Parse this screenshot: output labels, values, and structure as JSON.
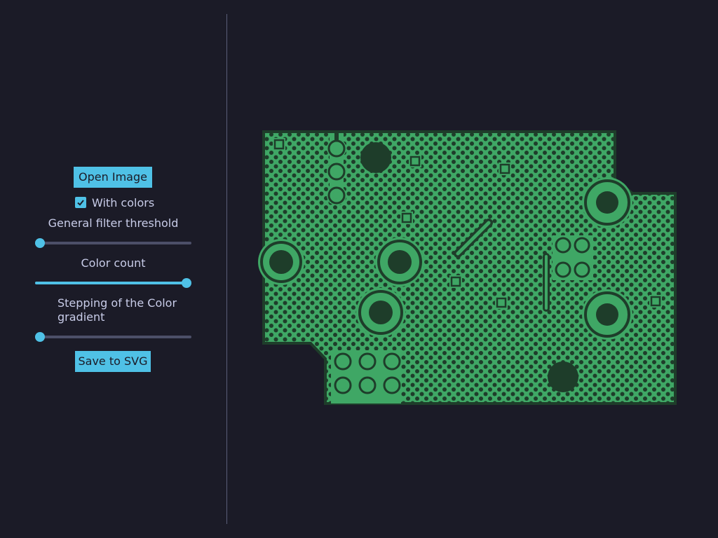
{
  "controls": {
    "open_button": "Open Image",
    "with_colors_label": "With colors",
    "with_colors_checked": true,
    "filter_threshold_label": "General filter threshold",
    "filter_threshold_value": 0.0,
    "color_count_label": "Color count",
    "color_count_value": 1.0,
    "gradient_step_label": "Stepping of the Color gradient",
    "gradient_step_value": 0.0,
    "save_button": "Save to SVG"
  },
  "image": {
    "fill_color": "#3fa765",
    "dark_color": "#1e3d2a",
    "background_color": "#1b1b27"
  },
  "theme": {
    "accent": "#4fc1e6",
    "text": "#c8cce8"
  }
}
